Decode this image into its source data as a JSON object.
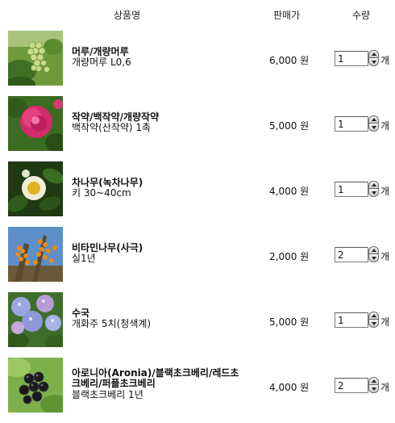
{
  "header": {
    "name": "상품명",
    "price": "판매가",
    "qty": "수량"
  },
  "products": [
    {
      "title": "머루/개량머루",
      "subtitle": "개량머루 L0,6",
      "price": "6,000 원",
      "qty": "1",
      "unit": "개",
      "image": "green-grapes-photo"
    },
    {
      "title": "작약/백작약/개량작약",
      "subtitle": "백작약(산작약) 1촉",
      "price": "5,000 원",
      "qty": "1",
      "unit": "개",
      "image": "pink-peony-photo"
    },
    {
      "title": "차나무(녹차나무)",
      "subtitle": "키 30~40cm",
      "price": "4,000 원",
      "qty": "1",
      "unit": "개",
      "image": "tea-flower-photo"
    },
    {
      "title": "비타민나무(사극)",
      "subtitle": "실1년",
      "price": "2,000 원",
      "qty": "2",
      "unit": "개",
      "image": "sea-buckthorn-photo"
    },
    {
      "title": "수국",
      "subtitle": "개화주 5치(청색계)",
      "price": "5,000 원",
      "qty": "1",
      "unit": "개",
      "image": "hydrangea-photo"
    },
    {
      "title": "아로니아(Aronia)/블랙초크베리/레드초크베리/퍼플초크베리",
      "subtitle": "블랙초크베리 1년",
      "price": "4,000 원",
      "qty": "2",
      "unit": "개",
      "image": "aronia-berries-photo"
    }
  ]
}
